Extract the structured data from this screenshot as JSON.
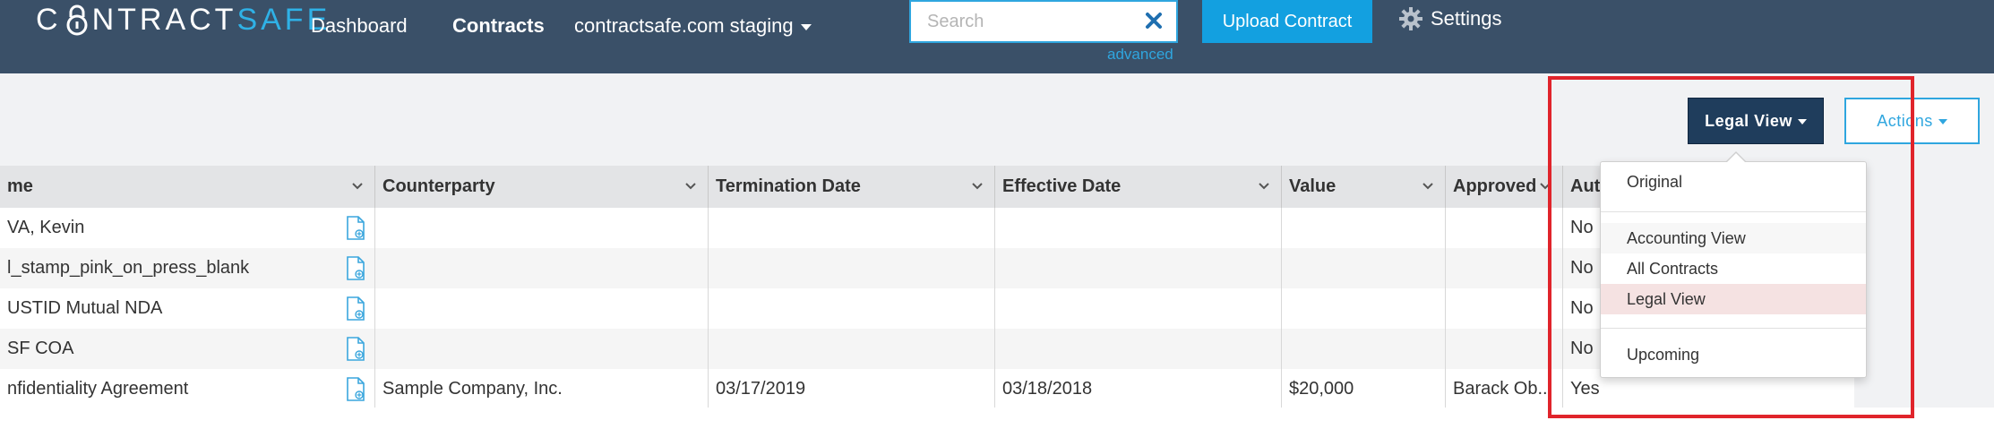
{
  "brand": {
    "logo_prefix": "C",
    "logo_middle": "NTRACT",
    "logo_suffix": "SAFE"
  },
  "nav": {
    "dashboard": "Dashboard",
    "contracts": "Contracts",
    "org": "contractsafe.com staging",
    "search_placeholder": "Search",
    "advanced": "advanced",
    "upload": "Upload Contract",
    "settings": "Settings"
  },
  "toolbar": {
    "legal_view": "Legal View",
    "actions": "Actions"
  },
  "table": {
    "headers": {
      "name": "me",
      "counterparty": "Counterparty",
      "termination": "Termination Date",
      "effective": "Effective Date",
      "value": "Value",
      "approved": "Approved",
      "auto": "Aut"
    },
    "rows": [
      {
        "name": "VA, Kevin",
        "counterparty": "",
        "termination": "",
        "effective": "",
        "value": "",
        "approved": "",
        "auto": "No"
      },
      {
        "name": "l_stamp_pink_on_press_blank",
        "counterparty": "",
        "termination": "",
        "effective": "",
        "value": "",
        "approved": "",
        "auto": "No"
      },
      {
        "name": "USTID Mutual NDA",
        "counterparty": "",
        "termination": "",
        "effective": "",
        "value": "",
        "approved": "",
        "auto": "No"
      },
      {
        "name": "SF COA",
        "counterparty": "",
        "termination": "",
        "effective": "",
        "value": "",
        "approved": "",
        "auto": "No"
      },
      {
        "name": "nfidentiality Agreement",
        "counterparty": "Sample Company, Inc.",
        "termination": "03/17/2019",
        "effective": "03/18/2018",
        "value": "$20,000",
        "approved": "Barack Ob...",
        "auto": "Yes"
      }
    ]
  },
  "view_menu": {
    "original": "Original",
    "accounting": "Accounting View",
    "all": "All Contracts",
    "legal": "Legal View",
    "upcoming": "Upcoming"
  },
  "colors": {
    "navbar": "#3a5068",
    "accent": "#13a0e0",
    "legal_btn": "#1f3d5c",
    "highlight": "#e0242b"
  }
}
